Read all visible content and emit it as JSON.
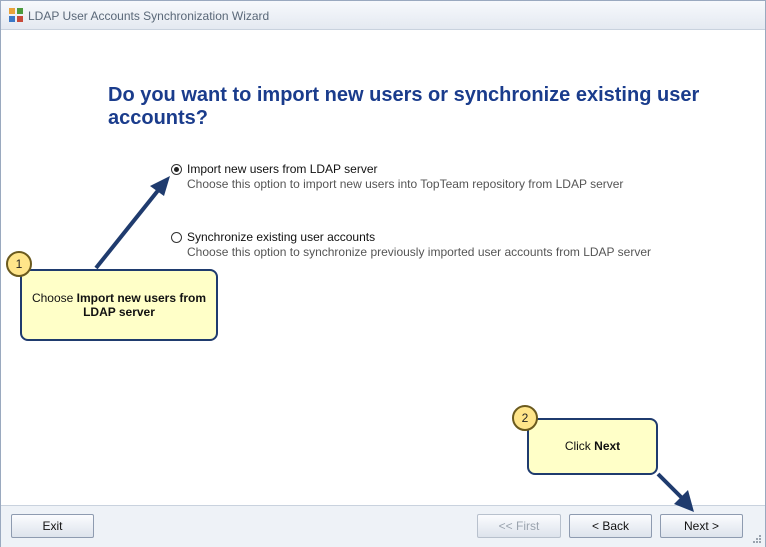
{
  "window": {
    "title": "LDAP User Accounts Synchronization Wizard"
  },
  "heading": "Do you want to import new users or synchronize existing user accounts?",
  "options": [
    {
      "label": "Import new users from LDAP server",
      "description": "Choose this option to import new users into TopTeam repository from LDAP server",
      "selected": true
    },
    {
      "label": "Synchronize existing user accounts",
      "description": "Choose this option to synchronize previously imported user accounts from LDAP server",
      "selected": false
    }
  ],
  "buttons": {
    "exit": "Exit",
    "first": "<< First",
    "back": "< Back",
    "next": "Next >"
  },
  "callouts": [
    {
      "number": "1",
      "prefix": "Choose ",
      "bold": "Import new users from LDAP server"
    },
    {
      "number": "2",
      "prefix": "Click ",
      "bold": "Next"
    }
  ],
  "colors": {
    "heading": "#1a3c8c",
    "callout_bg": "#ffffc8",
    "callout_border": "#1f3b6e",
    "arrow": "#1f3b6e"
  }
}
